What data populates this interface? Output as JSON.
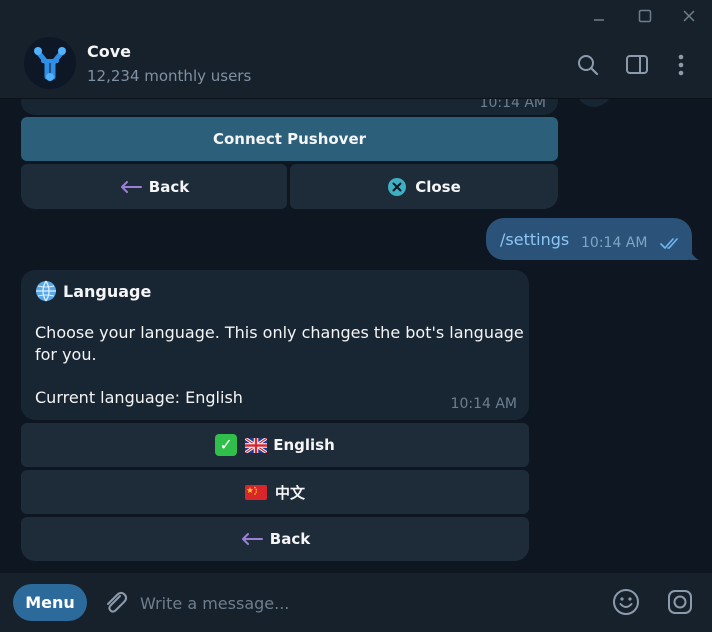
{
  "window": {
    "controls": [
      "minimize-icon",
      "maximize-icon",
      "close-icon"
    ]
  },
  "header": {
    "title": "Cove",
    "subtitle": "12,234 monthly users",
    "icons": [
      "search-icon",
      "sidebar-toggle-icon",
      "more-vertical-icon"
    ]
  },
  "messages": {
    "prev_time": "10:14 AM",
    "prev_keyboard": {
      "connect_label": "Connect Pushover",
      "back_label": "Back",
      "close_label": "Close"
    },
    "outgoing": {
      "text": "/settings",
      "time": "10:14 AM"
    },
    "language": {
      "title": "Language",
      "body": "Choose your language. This only changes the bot's language for you.",
      "current": "Current language: English",
      "time": "10:14 AM",
      "buttons": {
        "english_label": "English",
        "english_prefix": "✅",
        "chinese_label": "中文",
        "back_label": "Back"
      }
    }
  },
  "composer": {
    "menu_label": "Menu",
    "placeholder": "Write a message...",
    "icons": [
      "attach-icon",
      "emoji-icon",
      "camera-icon"
    ]
  },
  "colors": {
    "accent": "#2b6a9b",
    "connect_button": "#2b5f7a",
    "outgoing_bubble": "#2b5278",
    "incoming_bubble": "#182533",
    "background": "#0e1621"
  }
}
